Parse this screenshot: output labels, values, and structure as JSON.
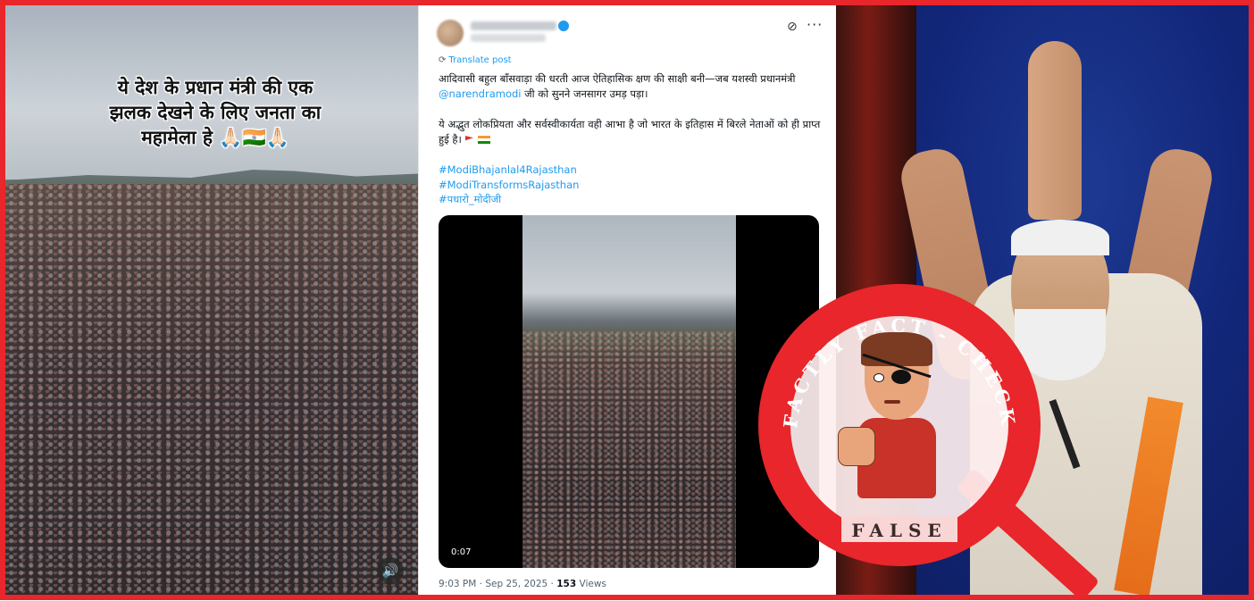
{
  "left_panel": {
    "caption_lines": [
      "ये देश के प्रधान मंत्री की एक",
      "झलक देखने के लिए जनता का",
      "महामेला हे 🙏🏻🇮🇳🙏🏻"
    ],
    "sound_icon": "🔊"
  },
  "tweet": {
    "more_icon": "···",
    "grok_icon": "⊘",
    "translate_label": "Translate post",
    "text_line1_pre": "आदिवासी बहुल बाँसवाड़ा की धरती आज ऐतिहासिक क्षण की साक्षी बनी—जब यशस्वी प्रधानमंत्री ",
    "mention": "@narendramodi",
    "text_line1_post": " जी को सुनने जनसागर उमड़ पड़ा।",
    "text_para2": "ये अद्भुत लोकप्रियता और सर्वस्वीकार्यता वही आभा है जो भारत के इतिहास में बिरले नेताओं को ही प्राप्त हुई है।",
    "hashtags": [
      "#ModiBhajanlal4Rajasthan",
      "#ModiTransformsRajasthan",
      "#पधारो_मोदीजी"
    ],
    "video_time": "0:07",
    "meta_time": "9:03 PM · Sep 25, 2025 · ",
    "views_count": "153",
    "views_label": " Views"
  },
  "badge": {
    "top_text": "FACTLY FACT - CHECK",
    "bottom_text": "FALSE",
    "color": "#e8262b"
  }
}
